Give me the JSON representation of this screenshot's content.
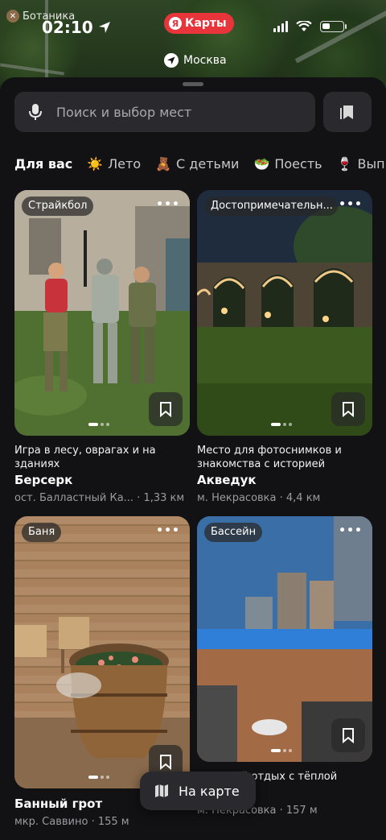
{
  "status_bar": {
    "poi_label": "Ботаника",
    "time": "02:10",
    "app_name": "Карты",
    "app_logo_letter": "Я"
  },
  "location": {
    "city": "Москва"
  },
  "search": {
    "placeholder": "Поиск и выбор мест"
  },
  "chips": [
    {
      "label": "Для вас",
      "emoji": ""
    },
    {
      "label": "Лето",
      "emoji": "☀️"
    },
    {
      "label": "С детьми",
      "emoji": "🧸"
    },
    {
      "label": "Поесть",
      "emoji": "🥗"
    },
    {
      "label": "Выпить",
      "emoji": "🍷"
    }
  ],
  "cards": [
    {
      "tag": "Страйкбол",
      "description": "Игра в лесу, оврагах и на зданиях",
      "title": "Берсерк",
      "meta": "ост. Балластный Ка... · 1,33 км"
    },
    {
      "tag": "Достопримечательн...",
      "description": "Место для фотоснимков и знакомства с историей",
      "title": "Акведук",
      "meta": "м. Некрасовка · 4,4 км"
    },
    {
      "tag": "Баня",
      "description": "",
      "title": "Банный грот",
      "meta": "мкр. Саввино · 155 м"
    },
    {
      "tag": "Бассейн",
      "description": "...ротный отдых с тёплой",
      "title": "...н",
      "meta": "м. Некрасовка · 157 м"
    }
  ],
  "map_button": {
    "label": "На карте"
  }
}
